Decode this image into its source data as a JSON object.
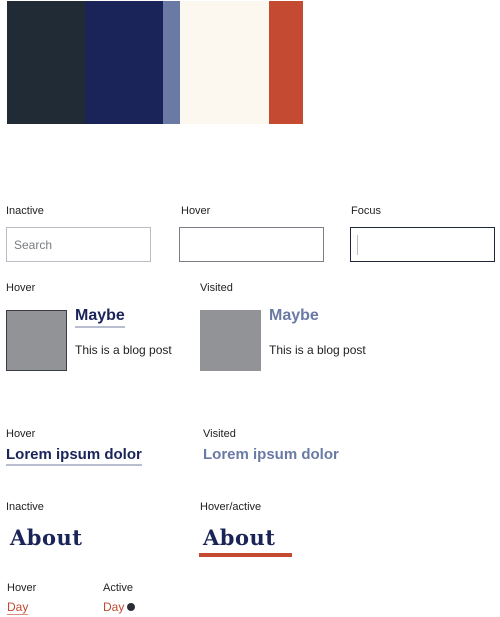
{
  "palette": {
    "colors": [
      "#212b36",
      "#1b2458",
      "#6a7aa4",
      "#fcf8ef",
      "#c44a32"
    ]
  },
  "inputs": {
    "inactive_label": "Inactive",
    "hover_label": "Hover",
    "focus_label": "Focus",
    "placeholder": "Search"
  },
  "blog_cards": {
    "hover_label": "Hover",
    "visited_label": "Visited",
    "title": "Maybe",
    "text": "This is a blog post"
  },
  "links": {
    "hover_label": "Hover",
    "visited_label": "Visited",
    "text": "Lorem ipsum dolor"
  },
  "nav": {
    "inactive_label": "Inactive",
    "active_label": "Hover/active",
    "item": "About"
  },
  "day_toggle": {
    "hover_label": "Hover",
    "active_label": "Active",
    "text": "Day"
  },
  "colors": {
    "navy": "#1b2458",
    "slate": "#6a7aa4",
    "accent": "#c44a32"
  }
}
